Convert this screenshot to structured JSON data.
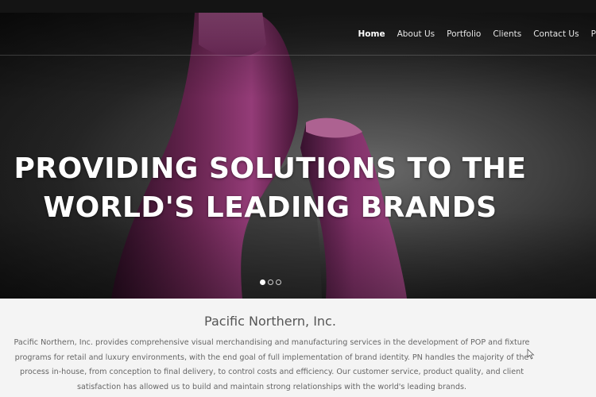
{
  "nav": {
    "items": [
      {
        "label": "Home",
        "active": true
      },
      {
        "label": "About Us",
        "active": false
      },
      {
        "label": "Portfolio",
        "active": false
      },
      {
        "label": "Clients",
        "active": false
      },
      {
        "label": "Contact Us",
        "active": false
      },
      {
        "label": "Press Relea",
        "active": false
      }
    ]
  },
  "hero": {
    "headline_line1": "PROVIDING SOLUTIONS TO THE",
    "headline_line2": "WORLD'S LEADING BRANDS",
    "slides_total": 3,
    "slide_active": 1,
    "accent": "#7a2a5c"
  },
  "about": {
    "title": "Pacific Northern, Inc.",
    "description": "Pacific Northern, Inc. provides comprehensive visual merchandising and manufacturing services in the development of POP and fixture programs for retail and luxury environments, with the end goal of full implementation of brand identity. PN handles the majority of the process in-house, from conception to final delivery, to control costs and efficiency. Our customer service, product quality, and client satisfaction has allowed us to build and maintain strong relationships with the world's leading brands."
  },
  "icons": {
    "cursor": "mouse-pointer-icon"
  }
}
